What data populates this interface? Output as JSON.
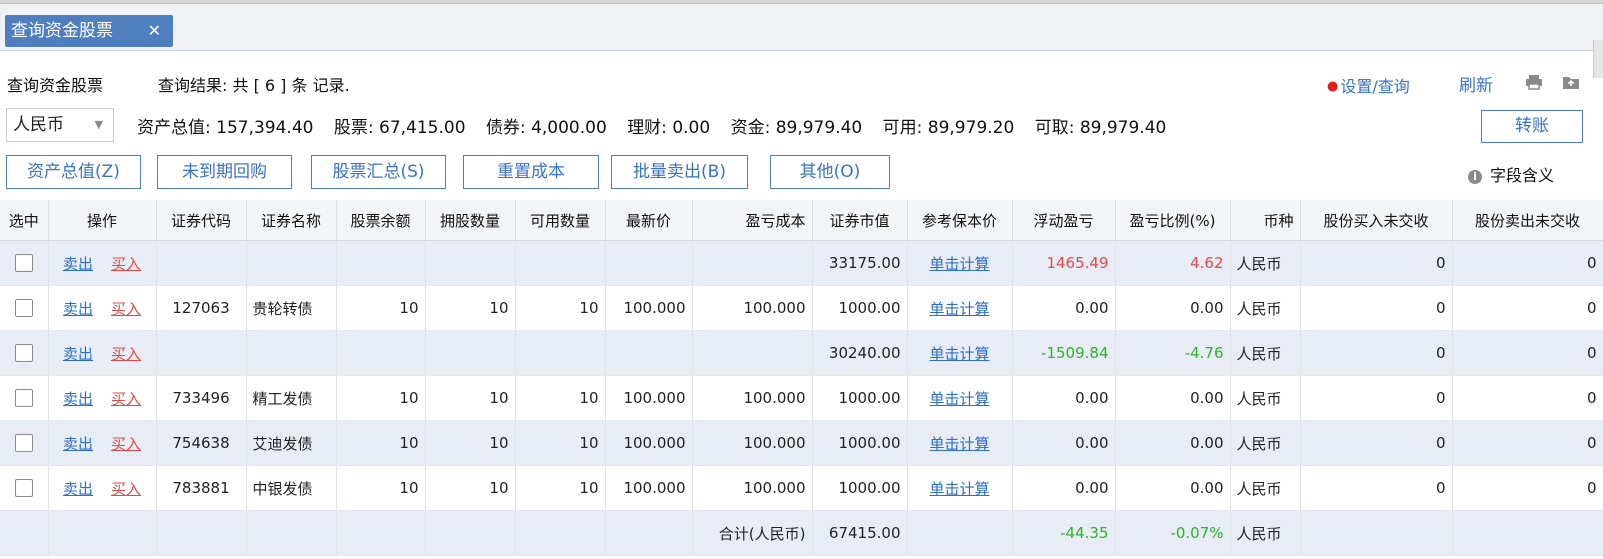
{
  "tab": {
    "title": "查询资金股票",
    "close": "✕"
  },
  "header": {
    "page_title": "查询资金股票",
    "result_text": "查询结果: 共 [ 6 ] 条 记录.",
    "settings_label": "设置/查询",
    "refresh_label": "刷新"
  },
  "account": {
    "currency": "人民币",
    "total_assets": "资产总值: 157,394.40",
    "stocks": "股票: 67,415.00",
    "bonds": "债券: 4,000.00",
    "wealth": "理财: 0.00",
    "funds": "资金: 89,979.40",
    "available": "可用: 89,979.20",
    "withdrawable": "可取: 89,979.40",
    "transfer_label": "转账"
  },
  "toolbar": {
    "total_assets_btn": "资产总值(Z)",
    "repo_btn": "未到期回购",
    "stock_summary_btn": "股票汇总(S)",
    "reset_cost_btn": "重置成本",
    "batch_sell_btn": "批量卖出(B)",
    "other_btn": "其他(O)",
    "field_help": "字段含义"
  },
  "table": {
    "headers": [
      "选中",
      "操作",
      "证券代码",
      "证券名称",
      "股票余额",
      "拥股数量",
      "可用数量",
      "最新价",
      "盈亏成本",
      "证券市值",
      "参考保本价",
      "浮动盈亏",
      "盈亏比例(%)",
      "币种",
      "股份买入未交收",
      "股份卖出未交收"
    ],
    "sell_label": "卖出",
    "buy_label": "买入",
    "rows": [
      {
        "code": "",
        "name": "",
        "balance": "",
        "held": "",
        "available": "",
        "price": "",
        "cost": "",
        "market_value": "33175.00",
        "breakeven": "单击计算",
        "pnl": "1465.49",
        "pnl_pct": "4.62",
        "currency": "人民币",
        "buy_unsettled": "0",
        "sell_unsettled": "0",
        "pnl_color": "pos"
      },
      {
        "code": "127063",
        "name": "贵轮转债",
        "balance": "10",
        "held": "10",
        "available": "10",
        "price": "100.000",
        "cost": "100.000",
        "market_value": "1000.00",
        "breakeven": "单击计算",
        "pnl": "0.00",
        "pnl_pct": "0.00",
        "currency": "人民币",
        "buy_unsettled": "0",
        "sell_unsettled": "0",
        "pnl_color": ""
      },
      {
        "code": "",
        "name": "",
        "balance": "",
        "held": "",
        "available": "",
        "price": "",
        "cost": "",
        "market_value": "30240.00",
        "breakeven": "单击计算",
        "pnl": "-1509.84",
        "pnl_pct": "-4.76",
        "currency": "人民币",
        "buy_unsettled": "0",
        "sell_unsettled": "0",
        "pnl_color": "neg"
      },
      {
        "code": "733496",
        "name": "精工发债",
        "balance": "10",
        "held": "10",
        "available": "10",
        "price": "100.000",
        "cost": "100.000",
        "market_value": "1000.00",
        "breakeven": "单击计算",
        "pnl": "0.00",
        "pnl_pct": "0.00",
        "currency": "人民币",
        "buy_unsettled": "0",
        "sell_unsettled": "0",
        "pnl_color": ""
      },
      {
        "code": "754638",
        "name": "艾迪发债",
        "balance": "10",
        "held": "10",
        "available": "10",
        "price": "100.000",
        "cost": "100.000",
        "market_value": "1000.00",
        "breakeven": "单击计算",
        "pnl": "0.00",
        "pnl_pct": "0.00",
        "currency": "人民币",
        "buy_unsettled": "0",
        "sell_unsettled": "0",
        "pnl_color": ""
      },
      {
        "code": "783881",
        "name": "中银发债",
        "balance": "10",
        "held": "10",
        "available": "10",
        "price": "100.000",
        "cost": "100.000",
        "market_value": "1000.00",
        "breakeven": "单击计算",
        "pnl": "0.00",
        "pnl_pct": "0.00",
        "currency": "人民币",
        "buy_unsettled": "0",
        "sell_unsettled": "0",
        "pnl_color": ""
      }
    ],
    "total": {
      "label": "合计(人民币)",
      "market_value": "67415.00",
      "pnl": "-44.35",
      "pnl_pct": "-0.07%",
      "currency": "人民币"
    }
  },
  "colors": {
    "accent": "#4f7fbf",
    "link": "#2c6fc6",
    "profit": "#e5484d",
    "loss": "#2bb32b",
    "row_alt": "#e8ecf4"
  }
}
